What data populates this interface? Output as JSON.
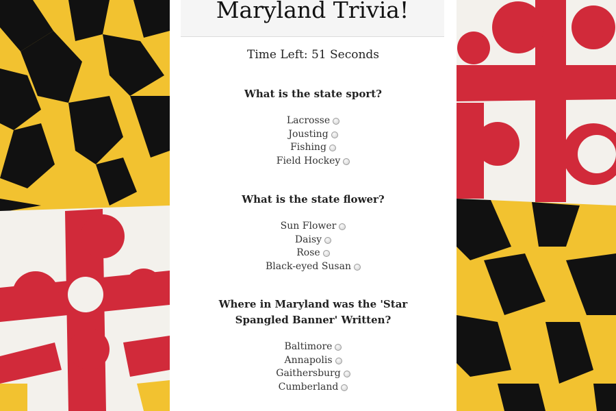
{
  "title": "Maryland Trivia!",
  "timer": "Time Left: 51 Seconds",
  "colors": {
    "flag_gold": "#f2c230",
    "flag_black": "#111111",
    "flag_red": "#d12a3a",
    "flag_white": "#f3f1ec",
    "title_bar": "#f5f5f5"
  },
  "questions": [
    {
      "question": "What is the state sport?",
      "answers": [
        "Lacrosse",
        "Jousting",
        "Fishing",
        "Field Hockey"
      ]
    },
    {
      "question": "What is the state flower?",
      "answers": [
        "Sun Flower",
        "Daisy",
        "Rose",
        "Black-eyed Susan"
      ]
    },
    {
      "question": "Where in Maryland was the 'Star Spangled Banner' Written?",
      "answers": [
        "Baltimore",
        "Annapolis",
        "Gaithersburg",
        "Cumberland"
      ]
    }
  ]
}
